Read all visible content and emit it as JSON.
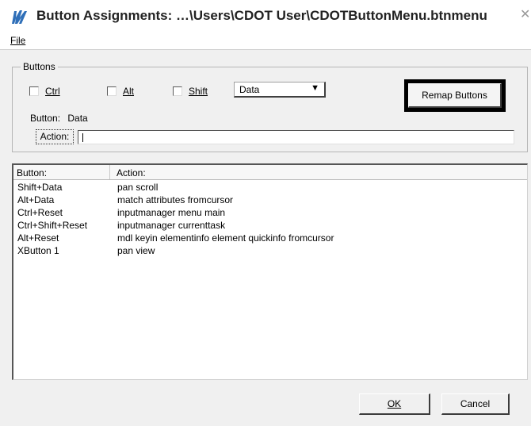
{
  "window": {
    "title": "Button Assignments: …\\Users\\CDOT User\\CDOTButtonMenu.btnmenu",
    "close_glyph": "✕",
    "app_icon": "bentley-button-assignments-icon",
    "accent_color": "#2f6fb8"
  },
  "menubar": {
    "file_label": "File"
  },
  "buttons_group": {
    "label": "Buttons",
    "ctrl": {
      "label": "Ctrl",
      "checked": false
    },
    "alt": {
      "label": "Alt",
      "checked": false
    },
    "shift": {
      "label": "Shift",
      "checked": false
    },
    "button_select": {
      "value": "Data",
      "arrow": "▼"
    },
    "remap_label": "Remap Buttons",
    "button_caption": "Button:",
    "button_value": "Data",
    "action_caption": "Action:",
    "action_value": ""
  },
  "list": {
    "columns": [
      "Button:",
      "Action:"
    ],
    "rows": [
      {
        "button": "Shift+Data",
        "action": "pan scroll"
      },
      {
        "button": "Alt+Data",
        "action": "match attributes fromcursor"
      },
      {
        "button": "Ctrl+Reset",
        "action": "inputmanager menu main"
      },
      {
        "button": "Ctrl+Shift+Reset",
        "action": "inputmanager currenttask"
      },
      {
        "button": "Alt+Reset",
        "action": "mdl keyin elementinfo element quickinfo fromcursor"
      },
      {
        "button": "XButton 1",
        "action": "pan view"
      }
    ]
  },
  "footer": {
    "ok_label": "OK",
    "cancel_label": "Cancel"
  }
}
